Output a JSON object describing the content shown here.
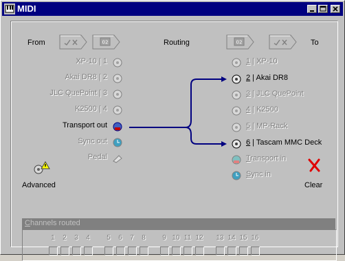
{
  "window": {
    "title": "MIDI"
  },
  "header": {
    "from_label": "From",
    "routing_label": "Routing",
    "to_label": "To",
    "from_badge": "02",
    "to_badge": "02"
  },
  "inputs": [
    {
      "label": "XP-10 | 1",
      "enabled": false
    },
    {
      "label": "Akai DR8 | 2",
      "enabled": false
    },
    {
      "label": "JLC QuePoint | 3",
      "enabled": false
    },
    {
      "label": "K2500 | 4",
      "enabled": false
    },
    {
      "label": "Transport out",
      "enabled": true
    },
    {
      "label": "Sync out",
      "enabled": false
    },
    {
      "label": "Pedal",
      "enabled": false
    }
  ],
  "outputs": [
    {
      "num": "1",
      "label": " | XP-10",
      "enabled": false
    },
    {
      "num": "2",
      "label": " | Akai DR8",
      "enabled": true
    },
    {
      "num": "3",
      "label": " | JLC QuePoint",
      "enabled": false
    },
    {
      "num": "4",
      "label": " | K2500",
      "enabled": false
    },
    {
      "num": "5",
      "label": " | MP-Rack",
      "enabled": false
    },
    {
      "num": "6",
      "label": " | Tascam MMC Deck",
      "enabled": true
    },
    {
      "num": "T",
      "label": "ransport in",
      "enabled": false
    },
    {
      "num": "S",
      "label": "ync in",
      "enabled": false
    }
  ],
  "buttons": {
    "advanced": "Advanced",
    "clear": "Clear"
  },
  "channels": {
    "header": "Channels routed",
    "header_first": "C",
    "header_rest": "hannels routed",
    "numbers": [
      "1",
      "2",
      "3",
      "4",
      "5",
      "6",
      "7",
      "8",
      "9",
      "10",
      "11",
      "12",
      "13",
      "14",
      "15",
      "16"
    ]
  },
  "colors": {
    "title_bar": "#000080",
    "route_line": "#000080",
    "face": "#c0c0c0"
  }
}
